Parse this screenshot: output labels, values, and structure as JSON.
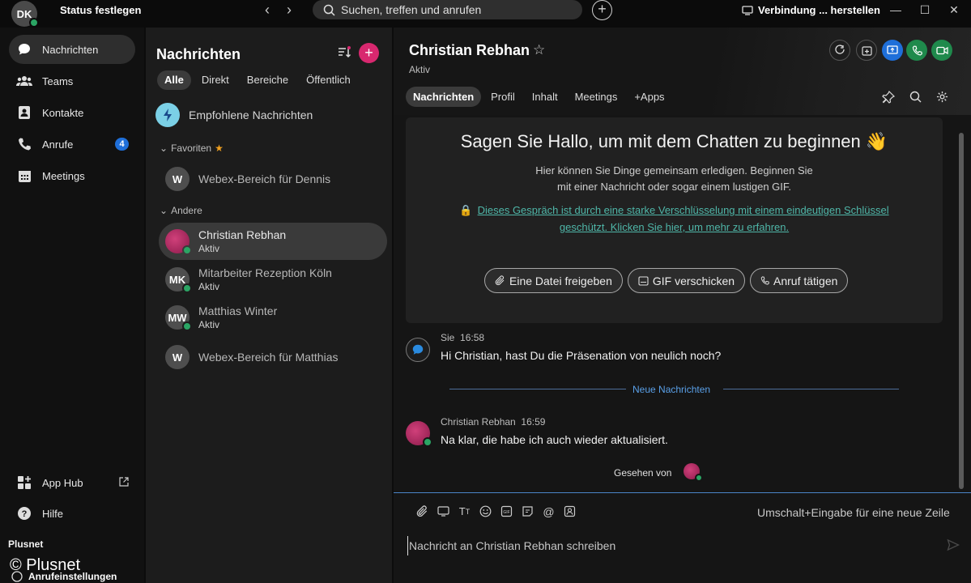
{
  "titlebar": {
    "avatar_initials": "DK",
    "status_label": "Status festlegen",
    "search_placeholder": "Suchen, treffen und anrufen",
    "connection_label": "Verbindung ... herstellen"
  },
  "sidebar": {
    "items": [
      {
        "label": "Nachrichten",
        "icon": "chat-bubble-icon"
      },
      {
        "label": "Teams",
        "icon": "teams-icon"
      },
      {
        "label": "Kontakte",
        "icon": "contacts-icon"
      },
      {
        "label": "Anrufe",
        "icon": "phone-icon",
        "badge": "4"
      },
      {
        "label": "Meetings",
        "icon": "calendar-icon"
      }
    ],
    "bottom": [
      {
        "label": "App Hub",
        "icon": "app-hub-icon"
      },
      {
        "label": "Hilfe",
        "icon": "help-icon"
      }
    ],
    "watermark_small": "Plusnet",
    "watermark_large": "© Plusnet",
    "call_settings": "Anrufeinstellungen"
  },
  "messages_list": {
    "title": "Nachrichten",
    "tabs": [
      "Alle",
      "Direkt",
      "Bereiche",
      "Öffentlich"
    ],
    "recommended": "Empfohlene Nachrichten",
    "favorites_label": "Favoriten",
    "others_label": "Andere",
    "favorites": [
      {
        "initial": "W",
        "name": "Webex-Bereich für Dennis"
      }
    ],
    "others": [
      {
        "name": "Christian Rebhan",
        "status": "Aktiv"
      },
      {
        "initial": "MK",
        "name": "Mitarbeiter Rezeption Köln",
        "status": "Aktiv"
      },
      {
        "initial": "MW",
        "name": "Matthias Winter",
        "status": "Aktiv"
      },
      {
        "initial": "W",
        "name": "Webex-Bereich für Matthias"
      }
    ]
  },
  "conversation": {
    "name": "Christian Rebhan",
    "status": "Aktiv",
    "tabs": [
      "Nachrichten",
      "Profil",
      "Inhalt",
      "Meetings",
      "+Apps"
    ],
    "welcome": {
      "title": "Sagen Sie Hallo, um mit dem Chatten zu beginnen 👋",
      "line1": "Hier können Sie Dinge gemeinsam erledigen. Beginnen Sie",
      "line2": "mit einer Nachricht oder sogar einem lustigen GIF.",
      "encryption_line1": "Dieses Gespräch ist durch eine starke Verschlüsselung mit einem eindeutigen Schlüssel",
      "encryption_line2": "geschützt. Klicken Sie hier, um mehr zu erfahren.",
      "buttons": [
        "Eine Datei freigeben",
        "GIF verschicken",
        "Anruf tätigen"
      ]
    },
    "messages": [
      {
        "sender": "Sie",
        "time": "16:58",
        "text": "Hi Christian, hast Du die Präsenation von neulich noch?"
      },
      {
        "sender": "Christian Rebhan",
        "time": "16:59",
        "text": "Na klar, die habe ich auch wieder aktualisiert."
      }
    ],
    "new_messages_label": "Neue Nachrichten",
    "seen_by": "Gesehen von",
    "composer_hint": "Umschalt+Eingabe für eine neue Zeile",
    "composer_placeholder": "Nachricht an Christian Rebhan schreiben"
  },
  "colors": {
    "accent_pink": "#d8286f",
    "presence_green": "#2ba564",
    "badge_blue": "#1f6fd9",
    "link_teal": "#4fb6a8"
  }
}
